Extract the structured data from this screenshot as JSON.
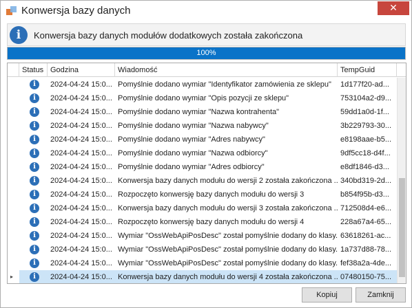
{
  "window": {
    "title": "Konwersja bazy danych",
    "close_glyph": "✕",
    "colors": {
      "close_button": "#c7463d",
      "progress": "#0a73c8",
      "info_icon": "#2c6fb7",
      "selection": "#cce4f7"
    }
  },
  "banner": {
    "icon": "info-icon",
    "text": "Konwersja bazy danych modułów dodatkowych została zakończona"
  },
  "progress": {
    "value": 1.0,
    "label": "100%"
  },
  "grid": {
    "columns": {
      "status": "Status",
      "godzina": "Godzina",
      "wiadomosc": "Wiadomość",
      "guid": "TempGuid"
    },
    "selected_indicator": "▸",
    "rows": [
      {
        "godzina": "2024-04-24 15:0...",
        "wiadomosc": "Pomyślnie dodano wymiar  \"Identyfikator zamówienia ze sklepu\"",
        "guid": "1d177f20-ad..."
      },
      {
        "godzina": "2024-04-24 15:0...",
        "wiadomosc": "Pomyślnie dodano wymiar  \"Opis pozycji ze sklepu\"",
        "guid": "753104a2-d9..."
      },
      {
        "godzina": "2024-04-24 15:0...",
        "wiadomosc": "Pomyślnie dodano wymiar  \"Nazwa kontrahenta\"",
        "guid": "59dd1a0d-1f..."
      },
      {
        "godzina": "2024-04-24 15:0...",
        "wiadomosc": "Pomyślnie dodano wymiar  \"Nazwa nabywcy\"",
        "guid": "3b229793-30..."
      },
      {
        "godzina": "2024-04-24 15:0...",
        "wiadomosc": "Pomyślnie dodano wymiar  \"Adres nabywcy\"",
        "guid": "e8198aae-b5..."
      },
      {
        "godzina": "2024-04-24 15:0...",
        "wiadomosc": "Pomyślnie dodano wymiar  \"Nazwa odbiorcy\"",
        "guid": "9df5cc18-d4f..."
      },
      {
        "godzina": "2024-04-24 15:0...",
        "wiadomosc": "Pomyślnie dodano wymiar  \"Adres odbiorcy\"",
        "guid": "e8df1846-d3..."
      },
      {
        "godzina": "2024-04-24 15:0...",
        "wiadomosc": "Konwersja bazy danych modułu do wersji 2 została zakończona ...",
        "guid": "340bd319-2d..."
      },
      {
        "godzina": "2024-04-24 15:0...",
        "wiadomosc": "Rozpoczęto konwersję bazy danych modułu do wersji 3",
        "guid": "b854f95b-d3..."
      },
      {
        "godzina": "2024-04-24 15:0...",
        "wiadomosc": "Konwersja bazy danych modułu do wersji 3 została zakończona ...",
        "guid": "712508d4-e6..."
      },
      {
        "godzina": "2024-04-24 15:0...",
        "wiadomosc": "Rozpoczęto konwersję bazy danych modułu do wersji 4",
        "guid": "228a67a4-65..."
      },
      {
        "godzina": "2024-04-24 15:0...",
        "wiadomosc": "Wymiar \"OssWebApiPosDesc\" został pomyślnie dodany do klasy...",
        "guid": "63618261-ac..."
      },
      {
        "godzina": "2024-04-24 15:0...",
        "wiadomosc": "Wymiar \"OssWebApiPosDesc\" został pomyślnie dodany do klasy...",
        "guid": "1a737d88-78..."
      },
      {
        "godzina": "2024-04-24 15:0...",
        "wiadomosc": "Wymiar \"OssWebApiPosDesc\" został pomyślnie dodany do klasy...",
        "guid": "fef38a2a-4de..."
      },
      {
        "godzina": "2024-04-24 15:0...",
        "wiadomosc": "Konwersja bazy danych modułu do wersji 4 została zakończona ...",
        "guid": "07480150-75...",
        "selected": true
      }
    ]
  },
  "buttons": {
    "copy": "Kopiuj",
    "close": "Zamknij"
  }
}
